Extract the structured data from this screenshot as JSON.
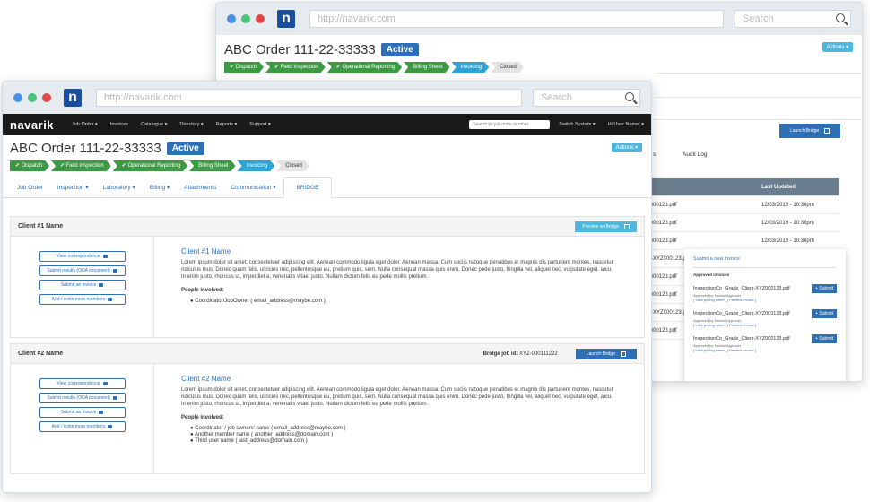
{
  "browser": {
    "url": "http://navarik.com",
    "search_placeholder": "Search",
    "logo_letter": "n"
  },
  "order": {
    "title": "ABC Order 111-22-33333",
    "status": "Active",
    "actions_label": "Actions ▾",
    "steps": [
      {
        "label": "✔ Dispatch",
        "state": "done"
      },
      {
        "label": "✔ Field Inspection",
        "state": "done"
      },
      {
        "label": "✔ Operational Reporting",
        "state": "done"
      },
      {
        "label": "Billing Sheet",
        "state": "done"
      },
      {
        "label": "Invoicing",
        "state": "current"
      },
      {
        "label": "Closed",
        "state": "pending"
      }
    ]
  },
  "navbar": {
    "brand": "navarik",
    "items": [
      "Job Order ▾",
      "Invoices",
      "Catalogue ▾",
      "Directory ▾",
      "Reports ▾",
      "Support ▾"
    ],
    "search_placeholder": "Search by job order number",
    "switch_system": "Switch System ▾",
    "user": "Hi User Name! ▾"
  },
  "tabs": [
    "Job Order",
    "Inspection ▾",
    "Laboratory ▾",
    "Billing ▾",
    "Attachments",
    "Communication ▾",
    "BRIDGE"
  ],
  "clients": [
    {
      "header": "Client #1 Name",
      "button": "Preview on Bridge",
      "bridge_label": "",
      "bridge_id": "",
      "name": "Client #1 Name",
      "lorem": "Lorem ipsum dolor sit amet, consectetuer adipiscing elit. Aenean commodo ligula eget dolor. Aenean massa. Cum sociis natoque penatibus et magnis dis parturient montes, nascetur ridiculus mus. Donec quam felis, ultricies nec, pellentesque eu, pretium quis, sem. Nulla consequat massa quis enim. Donec pede justo, fringilla vel, aliquet nec, vulputate eget, arcu. In enim justo, rhoncus ut, imperdiet a, venenatis vitae, justo. Nullam dictum felis eu pede mollis pretium.",
      "people_heading": "People involved:",
      "people": [
        "● Coordinator/JobOwner   ( email_address@maybe.com )"
      ]
    },
    {
      "header": "Client #2 Name",
      "button": "Launch Bridge",
      "bridge_label": "Bridge  job id:",
      "bridge_id": "XYZ-000111222",
      "name": "Client #2 Name",
      "lorem": "Lorem ipsum dolor sit amet, consectetuer adipiscing elit. Aenean commodo ligula eget dolor. Aenean massa. Cum sociis natoque penatibus et magnis dis parturient montes, nascetur ridiculus mus. Donec quam felis, ultricies nec, pellentesque eu, pretium quis, sem. Nulla consequat massa quis enim. Donec pede justo, fringilla vel, aliquet nec, vulputate eget, arcu. In enim justo, rhoncus ut, imperdiet a, venenatis vitae, justo. Nullam dictum felis eu pede mollis pretium.",
      "people_heading": "People involved:",
      "people": [
        "● Coordinator / job owners' name   ( email_address@maybe.com )",
        "● Another member name   ( another_address@domain.com )",
        "● Third user name   ( last_address@domain.com )"
      ]
    }
  ],
  "side_buttons": [
    "View correspondence",
    "Submit results (ODA document)",
    "Submit an invoice",
    "Add / invite more members"
  ],
  "back_window": {
    "launch_bridge": "Launch Bridge",
    "tab_partial": "s",
    "audit_log": "Audit Log",
    "table_header_last_updated": "Last Updated",
    "rows": [
      {
        "file": "Z000123.pdf",
        "date": "12/03/2019 - 10:30pm"
      },
      {
        "file": "Z000123.pdf",
        "date": "12/03/2019 - 10:30pm"
      },
      {
        "file": "Z000123.pdf",
        "date": "12/03/2019 - 10:30pm"
      },
      {
        "file": "nt-XYZ000123.pdf",
        "date": "12/03/2019 - 10:30pm"
      },
      {
        "file": "Z000123.pdf",
        "date": ""
      },
      {
        "file": "Z000123.pdf",
        "date": ""
      },
      {
        "file": "nt-XYZ000123.pdf",
        "date": ""
      },
      {
        "file": "Z000123.pdf",
        "date": ""
      }
    ],
    "submit_panel": {
      "title": "Submit a new invoice",
      "approved_label": "Approved invoices",
      "invoices": [
        {
          "file": "InspectionCo_Grade_Client-XYZ000123.pdf",
          "note": "Approved by Invoice Approver"
        },
        {
          "file": "InspectionCo_Grade_Client-XYZ000123.pdf",
          "note": "Approved by Invoice Approver"
        },
        {
          "file": "InspectionCo_Grade_Client-XYZ000123.pdf",
          "note": "Approved by Invoice Approver"
        }
      ],
      "submit_label": "+ Submit",
      "links": "[ View pricing sheet ]   [ Preview invoice ]"
    }
  },
  "colors": {
    "accent": "#2f6fb5",
    "done": "#3c9a45",
    "current": "#2fa3d6",
    "navbar": "#1a1a1a"
  }
}
